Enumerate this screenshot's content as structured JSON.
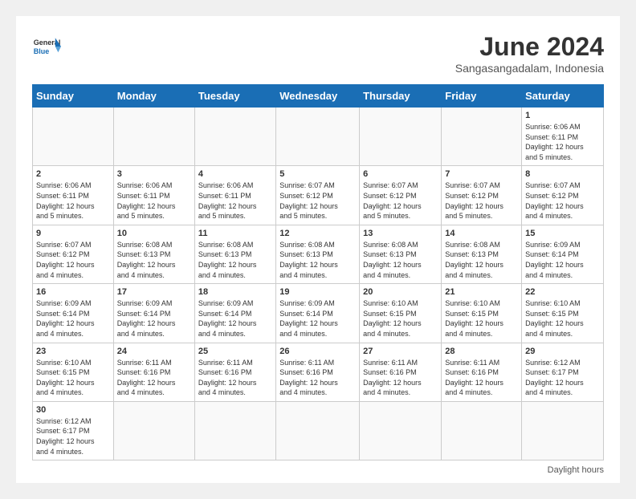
{
  "header": {
    "logo_general": "General",
    "logo_blue": "Blue",
    "month_title": "June 2024",
    "location": "Sangasangadalam, Indonesia"
  },
  "days_of_week": [
    "Sunday",
    "Monday",
    "Tuesday",
    "Wednesday",
    "Thursday",
    "Friday",
    "Saturday"
  ],
  "weeks": [
    [
      {
        "day": "",
        "info": ""
      },
      {
        "day": "",
        "info": ""
      },
      {
        "day": "",
        "info": ""
      },
      {
        "day": "",
        "info": ""
      },
      {
        "day": "",
        "info": ""
      },
      {
        "day": "",
        "info": ""
      },
      {
        "day": "1",
        "info": "Sunrise: 6:06 AM\nSunset: 6:11 PM\nDaylight: 12 hours\nand 5 minutes."
      }
    ],
    [
      {
        "day": "2",
        "info": "Sunrise: 6:06 AM\nSunset: 6:11 PM\nDaylight: 12 hours\nand 5 minutes."
      },
      {
        "day": "3",
        "info": "Sunrise: 6:06 AM\nSunset: 6:11 PM\nDaylight: 12 hours\nand 5 minutes."
      },
      {
        "day": "4",
        "info": "Sunrise: 6:06 AM\nSunset: 6:11 PM\nDaylight: 12 hours\nand 5 minutes."
      },
      {
        "day": "5",
        "info": "Sunrise: 6:07 AM\nSunset: 6:12 PM\nDaylight: 12 hours\nand 5 minutes."
      },
      {
        "day": "6",
        "info": "Sunrise: 6:07 AM\nSunset: 6:12 PM\nDaylight: 12 hours\nand 5 minutes."
      },
      {
        "day": "7",
        "info": "Sunrise: 6:07 AM\nSunset: 6:12 PM\nDaylight: 12 hours\nand 5 minutes."
      },
      {
        "day": "8",
        "info": "Sunrise: 6:07 AM\nSunset: 6:12 PM\nDaylight: 12 hours\nand 4 minutes."
      }
    ],
    [
      {
        "day": "9",
        "info": "Sunrise: 6:07 AM\nSunset: 6:12 PM\nDaylight: 12 hours\nand 4 minutes."
      },
      {
        "day": "10",
        "info": "Sunrise: 6:08 AM\nSunset: 6:13 PM\nDaylight: 12 hours\nand 4 minutes."
      },
      {
        "day": "11",
        "info": "Sunrise: 6:08 AM\nSunset: 6:13 PM\nDaylight: 12 hours\nand 4 minutes."
      },
      {
        "day": "12",
        "info": "Sunrise: 6:08 AM\nSunset: 6:13 PM\nDaylight: 12 hours\nand 4 minutes."
      },
      {
        "day": "13",
        "info": "Sunrise: 6:08 AM\nSunset: 6:13 PM\nDaylight: 12 hours\nand 4 minutes."
      },
      {
        "day": "14",
        "info": "Sunrise: 6:08 AM\nSunset: 6:13 PM\nDaylight: 12 hours\nand 4 minutes."
      },
      {
        "day": "15",
        "info": "Sunrise: 6:09 AM\nSunset: 6:14 PM\nDaylight: 12 hours\nand 4 minutes."
      }
    ],
    [
      {
        "day": "16",
        "info": "Sunrise: 6:09 AM\nSunset: 6:14 PM\nDaylight: 12 hours\nand 4 minutes."
      },
      {
        "day": "17",
        "info": "Sunrise: 6:09 AM\nSunset: 6:14 PM\nDaylight: 12 hours\nand 4 minutes."
      },
      {
        "day": "18",
        "info": "Sunrise: 6:09 AM\nSunset: 6:14 PM\nDaylight: 12 hours\nand 4 minutes."
      },
      {
        "day": "19",
        "info": "Sunrise: 6:09 AM\nSunset: 6:14 PM\nDaylight: 12 hours\nand 4 minutes."
      },
      {
        "day": "20",
        "info": "Sunrise: 6:10 AM\nSunset: 6:15 PM\nDaylight: 12 hours\nand 4 minutes."
      },
      {
        "day": "21",
        "info": "Sunrise: 6:10 AM\nSunset: 6:15 PM\nDaylight: 12 hours\nand 4 minutes."
      },
      {
        "day": "22",
        "info": "Sunrise: 6:10 AM\nSunset: 6:15 PM\nDaylight: 12 hours\nand 4 minutes."
      }
    ],
    [
      {
        "day": "23",
        "info": "Sunrise: 6:10 AM\nSunset: 6:15 PM\nDaylight: 12 hours\nand 4 minutes."
      },
      {
        "day": "24",
        "info": "Sunrise: 6:11 AM\nSunset: 6:16 PM\nDaylight: 12 hours\nand 4 minutes."
      },
      {
        "day": "25",
        "info": "Sunrise: 6:11 AM\nSunset: 6:16 PM\nDaylight: 12 hours\nand 4 minutes."
      },
      {
        "day": "26",
        "info": "Sunrise: 6:11 AM\nSunset: 6:16 PM\nDaylight: 12 hours\nand 4 minutes."
      },
      {
        "day": "27",
        "info": "Sunrise: 6:11 AM\nSunset: 6:16 PM\nDaylight: 12 hours\nand 4 minutes."
      },
      {
        "day": "28",
        "info": "Sunrise: 6:11 AM\nSunset: 6:16 PM\nDaylight: 12 hours\nand 4 minutes."
      },
      {
        "day": "29",
        "info": "Sunrise: 6:12 AM\nSunset: 6:17 PM\nDaylight: 12 hours\nand 4 minutes."
      }
    ],
    [
      {
        "day": "30",
        "info": "Sunrise: 6:12 AM\nSunset: 6:17 PM\nDaylight: 12 hours\nand 4 minutes."
      },
      {
        "day": "",
        "info": ""
      },
      {
        "day": "",
        "info": ""
      },
      {
        "day": "",
        "info": ""
      },
      {
        "day": "",
        "info": ""
      },
      {
        "day": "",
        "info": ""
      },
      {
        "day": "",
        "info": ""
      }
    ]
  ],
  "footer": {
    "daylight_label": "Daylight hours"
  }
}
